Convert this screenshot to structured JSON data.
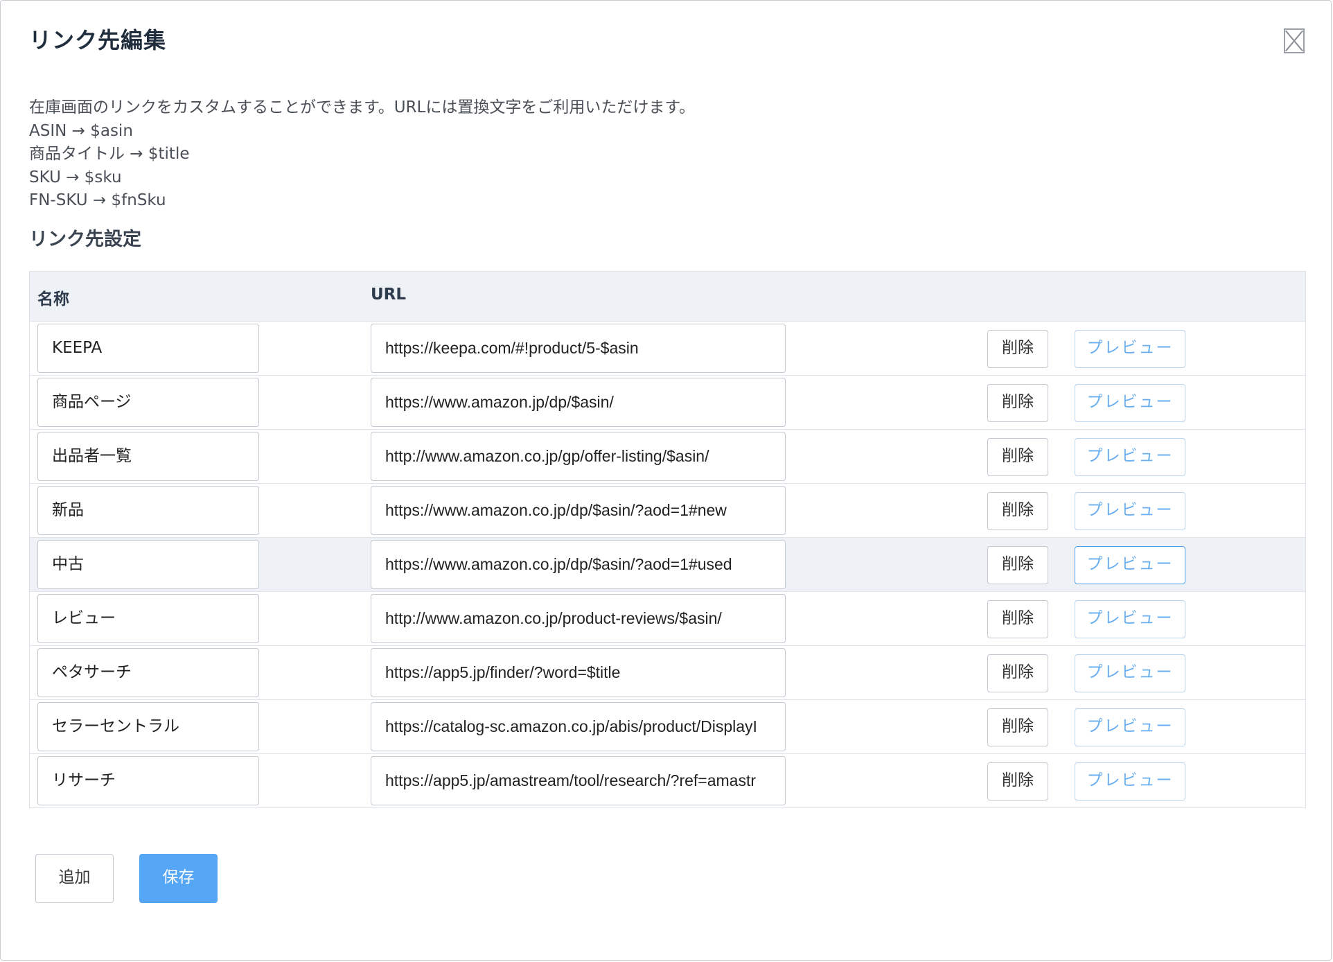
{
  "dialog": {
    "title": "リンク先編集",
    "close_label": ""
  },
  "description": {
    "intro": "在庫画面のリンクをカスタムすることができます。URLには置換文字をご利用いただけます。",
    "replacements": [
      "ASIN → $asin",
      "商品タイトル → $title",
      "SKU → $sku",
      "FN-SKU → $fnSku"
    ]
  },
  "section": {
    "title": "リンク先設定"
  },
  "table": {
    "headers": {
      "name": "名称",
      "url": "URL",
      "actions": ""
    },
    "rows": [
      {
        "name": "KEEPA",
        "url": "https://keepa.com/#!product/5-$asin",
        "delete_label": "削除",
        "preview_label": "プレビュー"
      },
      {
        "name": "商品ページ",
        "url": "https://www.amazon.jp/dp/$asin/",
        "delete_label": "削除",
        "preview_label": "プレビュー"
      },
      {
        "name": "出品者一覧",
        "url": "http://www.amazon.co.jp/gp/offer-listing/$asin/",
        "delete_label": "削除",
        "preview_label": "プレビュー"
      },
      {
        "name": "新品",
        "url": "https://www.amazon.co.jp/dp/$asin/?aod=1#new",
        "delete_label": "削除",
        "preview_label": "プレビュー"
      },
      {
        "name": "中古",
        "url": "https://www.amazon.co.jp/dp/$asin/?aod=1#used",
        "delete_label": "削除",
        "preview_label": "プレビュー"
      },
      {
        "name": "レビュー",
        "url": "http://www.amazon.co.jp/product-reviews/$asin/",
        "delete_label": "削除",
        "preview_label": "プレビュー"
      },
      {
        "name": "ペタサーチ",
        "url": "https://app5.jp/finder/?word=$title",
        "delete_label": "削除",
        "preview_label": "プレビュー"
      },
      {
        "name": "セラーセントラル",
        "url": "https://catalog-sc.amazon.co.jp/abis/product/DisplayI",
        "delete_label": "削除",
        "preview_label": "プレビュー"
      },
      {
        "name": "リサーチ",
        "url": "https://app5.jp/amastream/tool/research/?ref=amastr",
        "delete_label": "削除",
        "preview_label": "プレビュー"
      }
    ]
  },
  "footer": {
    "add_label": "追加",
    "save_label": "保存"
  },
  "colors": {
    "primary": "#55a6f5",
    "preview_text": "#6aaef0",
    "header_bg": "#eef1f5",
    "border": "#dfe3ea"
  }
}
